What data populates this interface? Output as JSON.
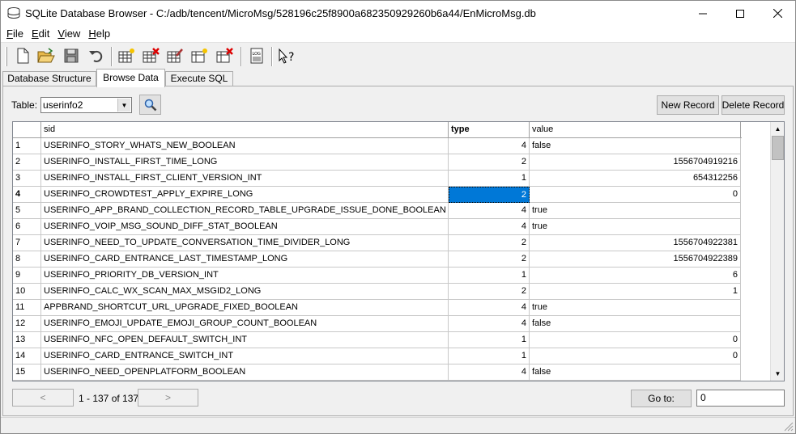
{
  "window": {
    "title": "SQLite Database Browser - C:/adb/tencent/MicroMsg/528196c25f8900a682350929260b6a44/EnMicroMsg.db",
    "icon": "database-icon"
  },
  "menu": [
    {
      "label": "File",
      "key": "F",
      "rest": "ile"
    },
    {
      "label": "Edit",
      "key": "E",
      "rest": "dit"
    },
    {
      "label": "View",
      "key": "V",
      "rest": "iew"
    },
    {
      "label": "Help",
      "key": "H",
      "rest": "elp"
    }
  ],
  "toolbar": {
    "icons": [
      "new-db-icon",
      "open-db-icon",
      "save-icon",
      "undo-icon",
      "create-table-icon",
      "delete-table-icon",
      "modify-table-icon",
      "create-index-icon",
      "delete-index-icon",
      "log-icon",
      "whats-this-icon"
    ]
  },
  "tabs": [
    {
      "label": "Database Structure",
      "active": false
    },
    {
      "label": "Browse Data",
      "active": true
    },
    {
      "label": "Execute SQL",
      "active": false
    }
  ],
  "browse": {
    "table_label": "Table:",
    "table_value": "userinfo2",
    "new_record": "New Record",
    "delete_record": "Delete Record"
  },
  "grid": {
    "columns": [
      "sid",
      "type",
      "value"
    ],
    "rows": [
      {
        "n": "1",
        "sid": "USERINFO_STORY_WHATS_NEW_BOOLEAN",
        "type": "4",
        "value": "false",
        "vnum": false
      },
      {
        "n": "2",
        "sid": "USERINFO_INSTALL_FIRST_TIME_LONG",
        "type": "2",
        "value": "1556704919216",
        "vnum": true
      },
      {
        "n": "3",
        "sid": "USERINFO_INSTALL_FIRST_CLIENT_VERSION_INT",
        "type": "1",
        "value": "654312256",
        "vnum": true
      },
      {
        "n": "4",
        "sid": "USERINFO_CROWDTEST_APPLY_EXPIRE_LONG",
        "type": "2",
        "value": "0",
        "vnum": true
      },
      {
        "n": "5",
        "sid": "USERINFO_APP_BRAND_COLLECTION_RECORD_TABLE_UPGRADE_ISSUE_DONE_BOOLEAN",
        "type": "4",
        "value": "true",
        "vnum": false
      },
      {
        "n": "6",
        "sid": "USERINFO_VOIP_MSG_SOUND_DIFF_STAT_BOOLEAN",
        "type": "4",
        "value": "true",
        "vnum": false
      },
      {
        "n": "7",
        "sid": "USERINFO_NEED_TO_UPDATE_CONVERSATION_TIME_DIVIDER_LONG",
        "type": "2",
        "value": "1556704922381",
        "vnum": true
      },
      {
        "n": "8",
        "sid": "USERINFO_CARD_ENTRANCE_LAST_TIMESTAMP_LONG",
        "type": "2",
        "value": "1556704922389",
        "vnum": true
      },
      {
        "n": "9",
        "sid": "USERINFO_PRIORITY_DB_VERSION_INT",
        "type": "1",
        "value": "6",
        "vnum": true
      },
      {
        "n": "10",
        "sid": "USERINFO_CALC_WX_SCAN_MAX_MSGID2_LONG",
        "type": "2",
        "value": "1",
        "vnum": true
      },
      {
        "n": "11",
        "sid": "APPBRAND_SHORTCUT_URL_UPGRADE_FIXED_BOOLEAN",
        "type": "4",
        "value": "true",
        "vnum": false
      },
      {
        "n": "12",
        "sid": "USERINFO_EMOJI_UPDATE_EMOJI_GROUP_COUNT_BOOLEAN",
        "type": "4",
        "value": "false",
        "vnum": false
      },
      {
        "n": "13",
        "sid": "USERINFO_NFC_OPEN_DEFAULT_SWITCH_INT",
        "type": "1",
        "value": "0",
        "vnum": true
      },
      {
        "n": "14",
        "sid": "USERINFO_CARD_ENTRANCE_SWITCH_INT",
        "type": "1",
        "value": "0",
        "vnum": true
      },
      {
        "n": "15",
        "sid": "USERINFO_NEED_OPENPLATFORM_BOOLEAN",
        "type": "4",
        "value": "false",
        "vnum": false
      }
    ],
    "current_row": 4
  },
  "pager": {
    "prev": "<",
    "next": ">",
    "info": "1 - 137 of 137",
    "goto_label": "Go to:",
    "goto_value": "0"
  }
}
